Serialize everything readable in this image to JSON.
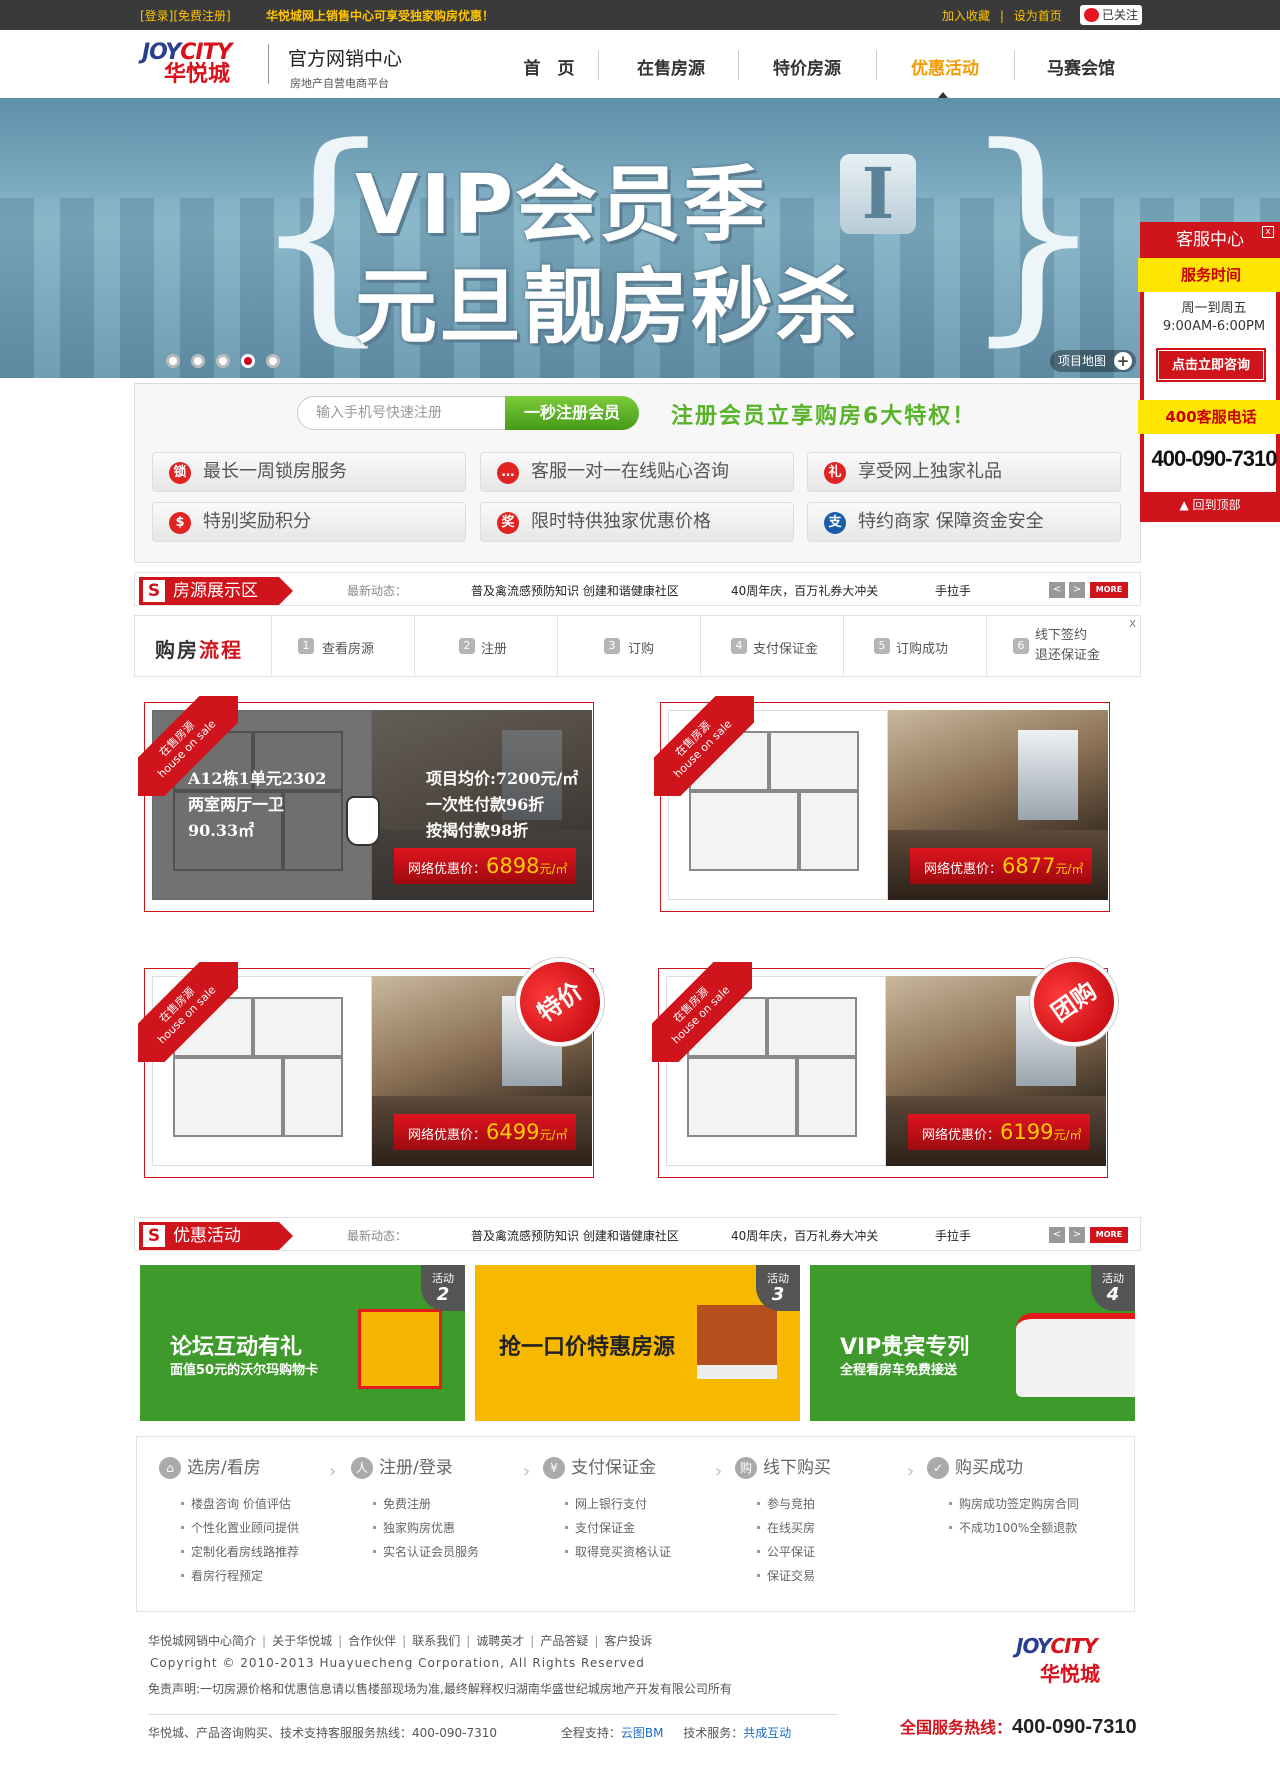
{
  "topbar": {
    "login": "[登录]",
    "register": "[免费注册]",
    "tip": "华悦城网上销售中心可享受独家购房优惠！",
    "fav": "加入收藏",
    "sep": "|",
    "home": "设为首页",
    "weibo": "已关注"
  },
  "header": {
    "logo_en_1": "JOY",
    "logo_en_2": "CITY",
    "logo_cn": "华悦城",
    "title": "官方网销中心",
    "subtitle": "房地产自营电商平台",
    "nav": [
      "首　页",
      "在售房源",
      "特价房源",
      "优惠活动",
      "马赛会馆"
    ],
    "active_nav": 3
  },
  "banner": {
    "line1": "VIP会员季",
    "badge": "I",
    "line2": "元旦靓房秒杀",
    "dots": 5,
    "active_dot": 4,
    "map_btn": "项目地图",
    "plus": "+"
  },
  "register": {
    "placeholder": "输入手机号快速注册",
    "button": "一秒注册会员",
    "slogan": "注册会员立享购房6大特权！",
    "perks": [
      {
        "icon": "lock-icon",
        "glyph": "锁",
        "label": "最长一周锁房服务"
      },
      {
        "icon": "chat-icon",
        "glyph": "…",
        "label": "客服一对一在线贴心咨询"
      },
      {
        "icon": "gift-icon",
        "glyph": "礼",
        "label": "享受网上独家礼品"
      },
      {
        "icon": "coin-icon",
        "glyph": "$",
        "label": "特别奖励积分"
      },
      {
        "icon": "medal-icon",
        "glyph": "奖",
        "label": "限时特供独家优惠价格"
      },
      {
        "icon": "alipay-icon",
        "glyph": "支",
        "label": "特约商家 保障资金安全"
      }
    ]
  },
  "section1": {
    "tag_s": "S",
    "title": "房源展示区",
    "news_label": "最新动态：",
    "news": [
      "普及禽流感预防知识 创建和谐健康社区",
      "40周年庆，百万礼券大冲关",
      "手拉手"
    ],
    "prev": "<",
    "next": ">",
    "more": "MORE"
  },
  "process": {
    "title_a": "购房",
    "title_b": "流程",
    "steps": [
      {
        "n": "1",
        "label": "查看房源"
      },
      {
        "n": "2",
        "label": "注册"
      },
      {
        "n": "3",
        "label": "订购"
      },
      {
        "n": "4",
        "label": "支付保证金"
      },
      {
        "n": "5",
        "label": "订购成功"
      },
      {
        "n": "6",
        "label": "线下签约\n退还保证金"
      }
    ],
    "close": "x"
  },
  "houses": {
    "ribbon_cn": "在售房源",
    "ribbon_en": "house on sale",
    "price_label": "网络优惠价：",
    "unit": "元/㎡",
    "cards": [
      {
        "price": "6898",
        "badge": ""
      },
      {
        "price": "6877",
        "badge": ""
      },
      {
        "price": "6499",
        "badge": "特价"
      },
      {
        "price": "6199",
        "badge": "团购"
      }
    ],
    "hover": {
      "l1": "A12栋1单元2302",
      "l2": "两室两厅一卫",
      "l3": "90.33㎡",
      "r1": "项目均价:7200元/㎡",
      "r2": "一次性付款96折",
      "r3": "按揭付款98折"
    }
  },
  "section2": {
    "tag_s": "S",
    "title": "优惠活动",
    "news_label": "最新动态：",
    "news": [
      "普及禽流感预防知识 创建和谐健康社区",
      "40周年庆，百万礼券大冲关",
      "手拉手"
    ],
    "prev": "<",
    "next": ">",
    "more": "MORE"
  },
  "activities": [
    {
      "tag": "活动",
      "num": "2",
      "t1": "论坛互动有礼",
      "t2": "面值50元的沃尔玛购物卡",
      "bg": "#3e9a2a"
    },
    {
      "tag": "活动",
      "num": "3",
      "t1": "抢一口价特惠房源",
      "t2": "",
      "bg": "#f6b900"
    },
    {
      "tag": "活动",
      "num": "4",
      "t1": "VIP贵宾专列",
      "t2": "全程看房车免费接送",
      "bg": "#3e9a2a"
    }
  ],
  "guide": [
    {
      "icon": "house-icon",
      "glyph": "⌂",
      "title": "选房/看房",
      "items": [
        "楼盘咨询 价值评估",
        "个性化置业顾问提供",
        "定制化看房线路推荐",
        "看房行程预定"
      ]
    },
    {
      "icon": "user-icon",
      "glyph": "人",
      "title": "注册/登录",
      "items": [
        "免费注册",
        "独家购房优惠",
        "实名认证会员服务"
      ]
    },
    {
      "icon": "yen-icon",
      "glyph": "¥",
      "title": "支付保证金",
      "items": [
        "网上银行支付",
        "支付保证金",
        "取得竞买资格认证"
      ]
    },
    {
      "icon": "basket-icon",
      "glyph": "购",
      "title": "线下购买",
      "items": [
        "参与竞拍",
        "在线买房",
        "公平保证",
        "保证交易"
      ]
    },
    {
      "icon": "check-icon",
      "glyph": "✓",
      "title": "购买成功",
      "items": [
        "购房成功签定购房合同",
        "不成功100%全额退款"
      ]
    }
  ],
  "side": {
    "head": "客服中心",
    "close": "x",
    "hours_title": "服务时间",
    "hours_1": "周一到周五",
    "hours_2": "9:00AM-6:00PM",
    "consult": "点击立即咨询",
    "tel_title": "400客服电话",
    "tel": "400-090-7310",
    "top": "回到顶部"
  },
  "footer": {
    "links": [
      "华悦城网销中心简介",
      "关于华悦城",
      "合作伙伴",
      "联系我们",
      "诚聘英才",
      "产品答疑",
      "客户投诉"
    ],
    "copyright": "Copyright © 2010-2013 Huayuecheng Corporation, All Rights Reserved",
    "disclaimer": "免责声明:一切房源价格和优惠信息请以售楼部现场为准,最终解释权归湖南华盛世纪城房地产开发有限公司所有",
    "support_text": "华悦城、产品咨询购买、技术支持客服服务热线：400-090-7310",
    "support_label": "全程支持：",
    "support_name": "云图BM",
    "tech_label": "技术服务：",
    "tech_name": "共成互动",
    "hotline_label": "全国服务热线：",
    "hotline": "400-090-7310"
  }
}
